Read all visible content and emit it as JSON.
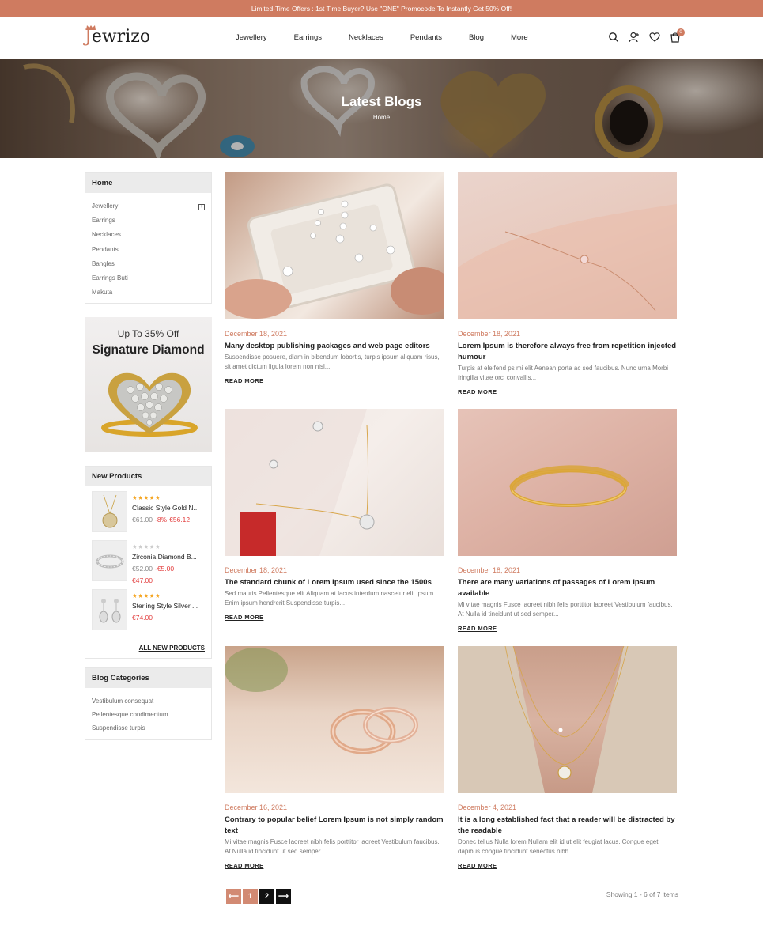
{
  "topbar": {
    "text": "Limited-Time Offers : 1st Time Buyer? Use \"ONE\" Promocode To Instantly Get 50% Off!"
  },
  "header": {
    "logo_first": "J",
    "logo_rest": "ewrizo",
    "nav": [
      "Jewellery",
      "Earrings",
      "Necklaces",
      "Pendants",
      "Blog",
      "More"
    ],
    "cart_count": "0"
  },
  "hero": {
    "title": "Latest Blogs",
    "breadcrumb": "Home"
  },
  "sidebar": {
    "categories": {
      "head": "Home",
      "items": [
        "Jewellery",
        "Earrings",
        "Necklaces",
        "Pendants",
        "Bangles",
        "Earrings Buti",
        "Makuta"
      ]
    },
    "promo": {
      "top": "Up To 35% Off",
      "main": "Signature Diamond"
    },
    "new_products": {
      "head": "New Products",
      "items": [
        {
          "name": "Classic Style Gold N...",
          "rating": 5,
          "old_price": "€61.00",
          "discount": "-8%",
          "price": "€56.12"
        },
        {
          "name": "Zirconia Diamond B...",
          "rating": 0,
          "old_price": "€52.00",
          "discount": "-€5.00",
          "price": "€47.00"
        },
        {
          "name": "Sterling Style Silver ...",
          "rating": 5,
          "old_price": "",
          "discount": "",
          "price": "€74.00"
        }
      ],
      "all_link": "ALL NEW PRODUCTS"
    },
    "blog_categories": {
      "head": "Blog Categories",
      "items": [
        "Vestibulum consequat",
        "Pellentesque condimentum",
        "Suspendisse turpis"
      ]
    }
  },
  "posts": [
    {
      "date": "December 18, 2021",
      "title": "Many desktop publishing packages and web page editors",
      "excerpt": "Suspendisse posuere, diam in bibendum lobortis, turpis ipsum aliquam risus, sit amet dictum ligula lorem non nisl...",
      "more": "READ MORE"
    },
    {
      "date": "December 18, 2021",
      "title": "Lorem Ipsum is therefore always free from repetition injected humour",
      "excerpt": "Turpis at eleifend ps mi elit Aenean porta ac sed faucibus. Nunc urna Morbi fringilla vitae orci convallis...",
      "more": "READ MORE"
    },
    {
      "date": "December 18, 2021",
      "title": "The standard chunk of Lorem Ipsum used since the 1500s",
      "excerpt": "Sed mauris Pellentesque elit Aliquam at lacus interdum nascetur elit ipsum. Enim ipsum hendrerit Suspendisse turpis...",
      "more": "READ MORE"
    },
    {
      "date": "December 18, 2021",
      "title": "There are many variations of passages of Lorem Ipsum available",
      "excerpt": "Mi vitae magnis Fusce laoreet nibh felis porttitor laoreet Vestibulum faucibus. At Nulla id tincidunt ut sed semper...",
      "more": "READ MORE"
    },
    {
      "date": "December 16, 2021",
      "title": "Contrary to popular belief Lorem Ipsum is not simply random text",
      "excerpt": "Mi vitae magnis Fusce laoreet nibh felis porttitor laoreet Vestibulum faucibus. At Nulla id tincidunt ut sed semper...",
      "more": "READ MORE"
    },
    {
      "date": "December 4, 2021",
      "title": "It is a long established fact that a reader will be distracted by the readable",
      "excerpt": "Donec tellus Nulla lorem Nullam elit id ut elit feugiat lacus. Congue eget dapibus congue tincidunt senectus nibh...",
      "more": "READ MORE"
    }
  ],
  "pagination": {
    "prev": "⟵",
    "pages": [
      "1",
      "2"
    ],
    "next": "⟶",
    "showing": "Showing 1 - 6 of 7 items"
  },
  "colors": {
    "accent": "#cf7b60",
    "star": "#f5a623",
    "sale": "#e23b3b"
  }
}
